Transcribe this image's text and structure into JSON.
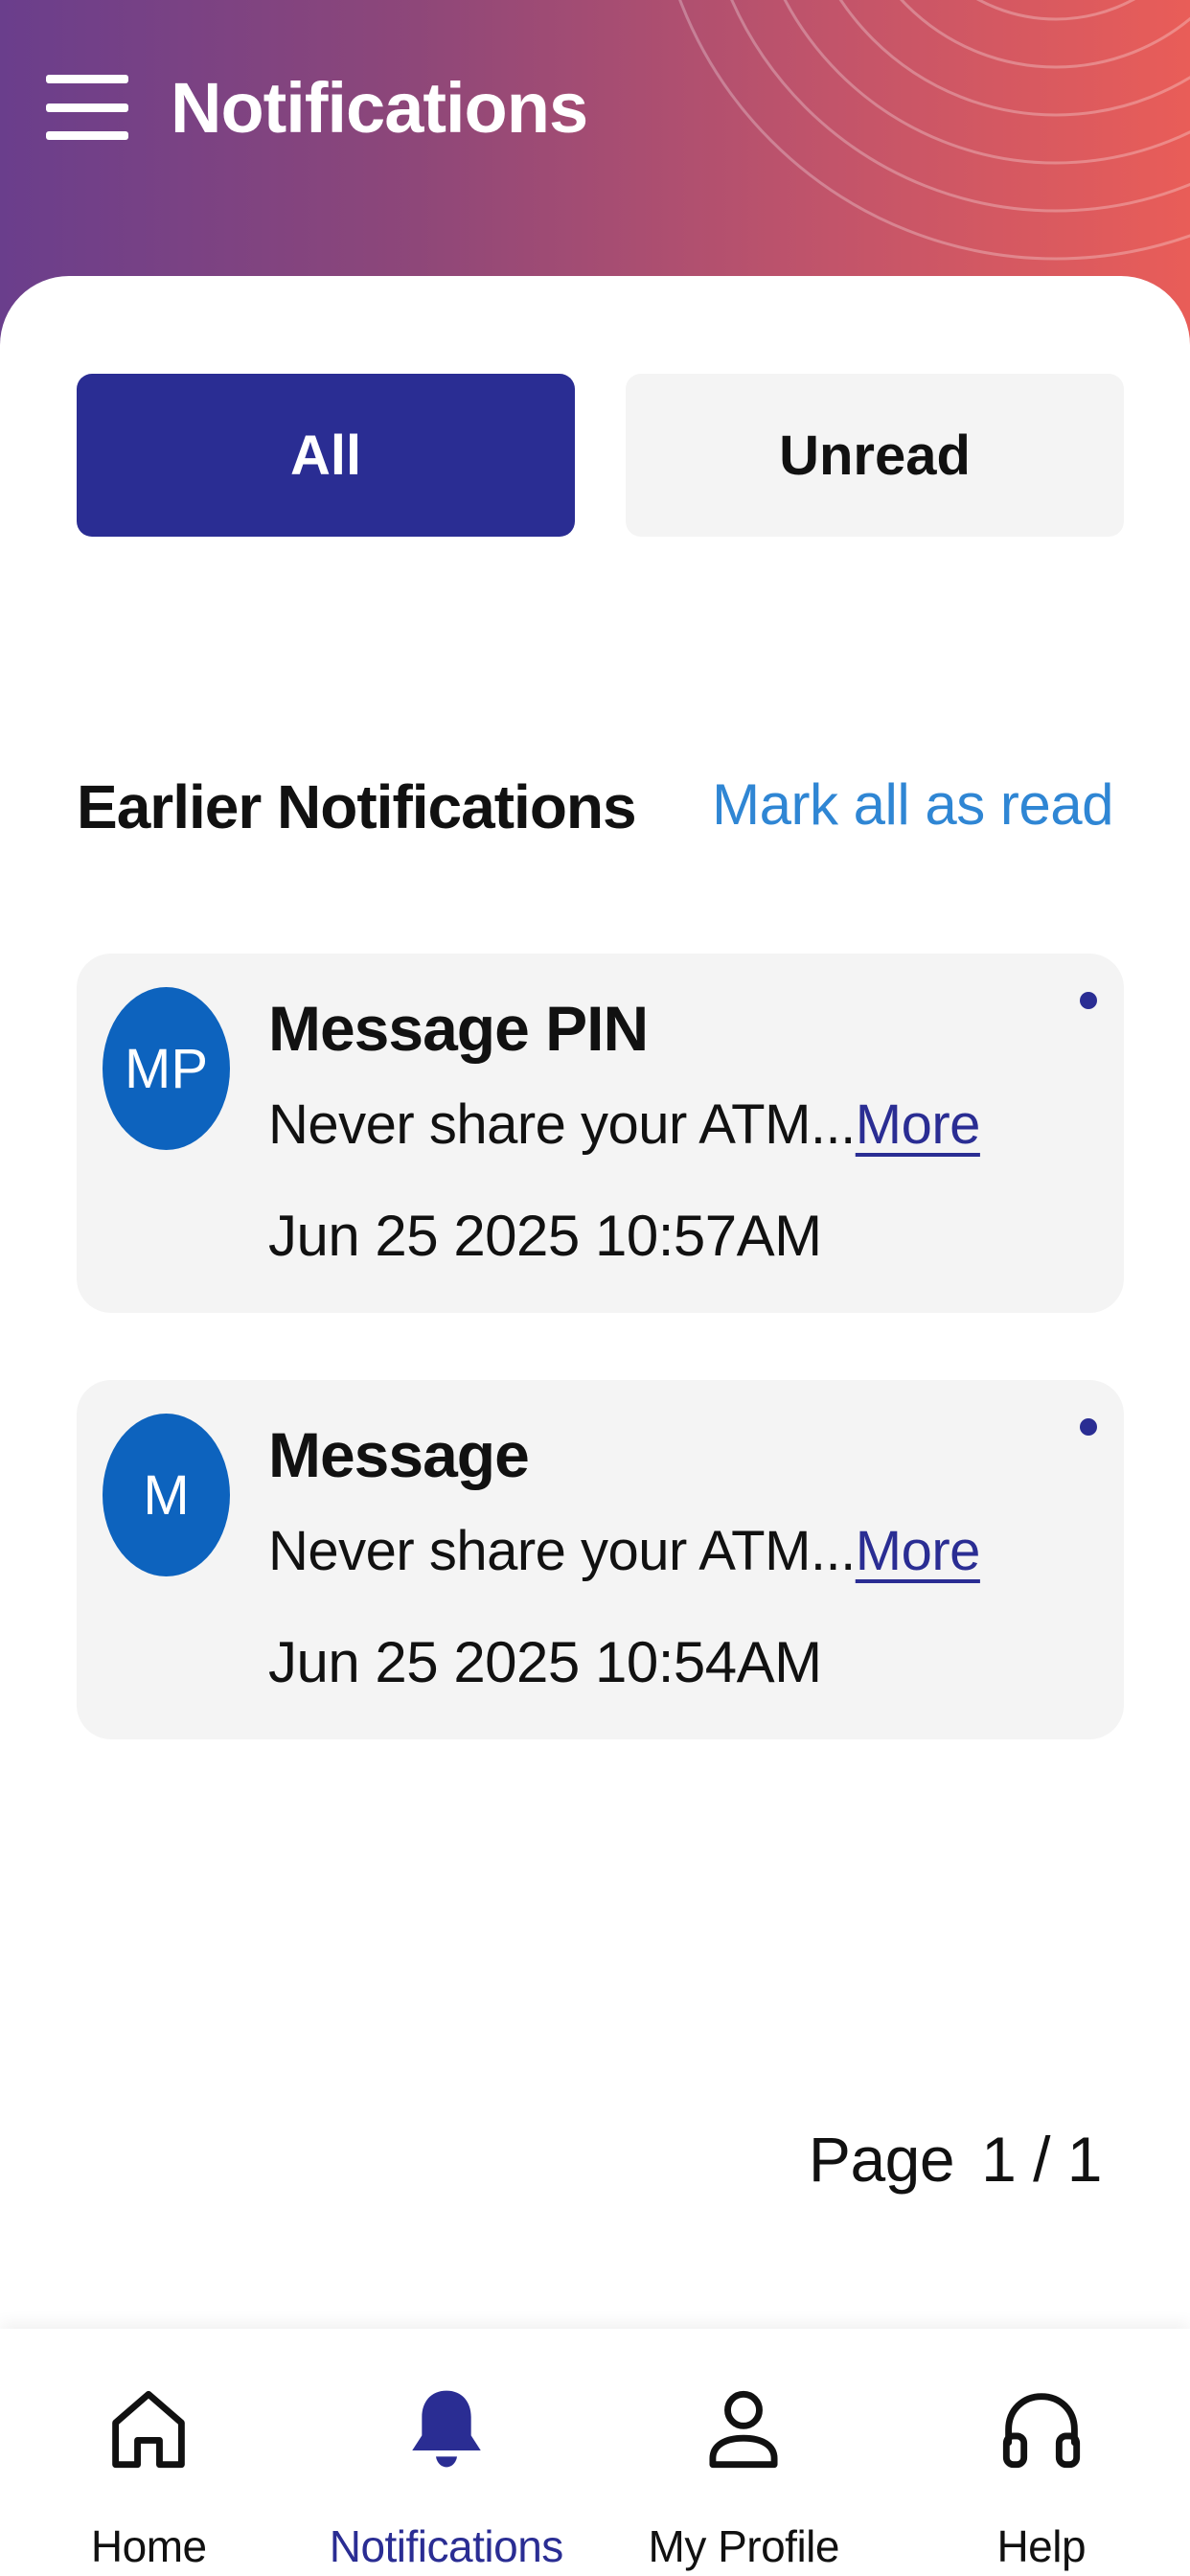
{
  "header": {
    "title": "Notifications",
    "menu_icon": "hamburger-menu-icon"
  },
  "tabs": [
    {
      "label": "All",
      "active": true
    },
    {
      "label": "Unread",
      "active": false
    }
  ],
  "section": {
    "title": "Earlier Notifications",
    "mark_all_label": "Mark all as read"
  },
  "notifications": [
    {
      "initials": "MP",
      "title": "Message PIN",
      "preview": "Never share your ATM...",
      "more_label": "More",
      "date": "Jun 25 2025 10:57AM",
      "unread": true
    },
    {
      "initials": "M",
      "title": "Message",
      "preview": "Never share your ATM...",
      "more_label": "More",
      "date": "Jun 25 2025 10:54AM",
      "unread": true
    }
  ],
  "pagination": {
    "label": "Page",
    "value": "1 / 1"
  },
  "bottom_nav": [
    {
      "label": "Home",
      "icon": "home-icon",
      "active": false
    },
    {
      "label": "Notifications",
      "icon": "bell-icon",
      "active": true
    },
    {
      "label": "My Profile",
      "icon": "user-icon",
      "active": false
    },
    {
      "label": "Help",
      "icon": "headphones-icon",
      "active": false
    }
  ],
  "colors": {
    "primary": "#2a2d93",
    "link": "#2f86d4",
    "avatar": "#0d63be",
    "card_bg": "#f4f4f4",
    "header_gradient_start": "#6a3e8c",
    "header_gradient_end": "#e95d58"
  }
}
